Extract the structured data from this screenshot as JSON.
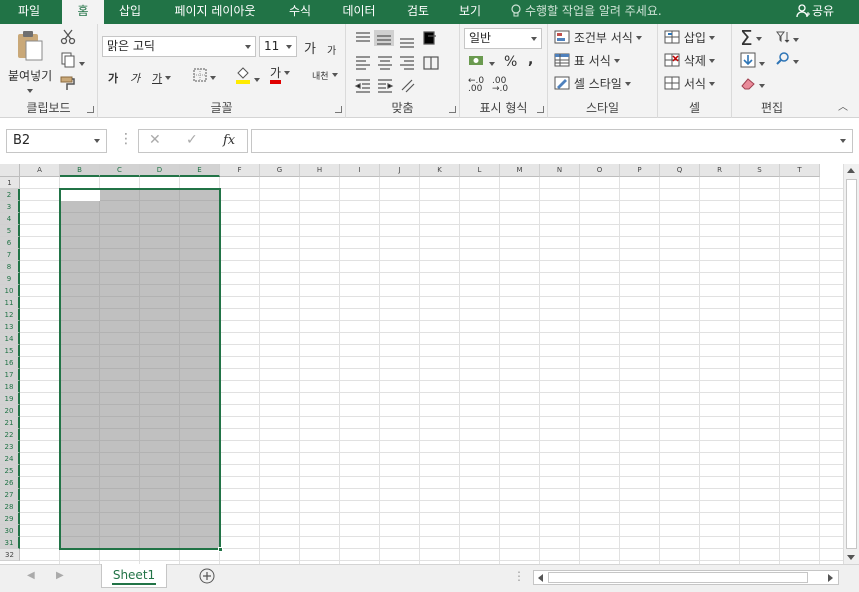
{
  "tabs": [
    "파일",
    "홈",
    "삽입",
    "페이지 레이아웃",
    "수식",
    "데이터",
    "검토",
    "보기"
  ],
  "active_tab": "홈",
  "tell_me": "수행할 작업을 알려 주세요.",
  "share": "공유",
  "ribbon": {
    "clipboard": {
      "paste": "붙여넣기",
      "label": "클립보드"
    },
    "font": {
      "name": "맑은 고딕",
      "size": "11",
      "grow": "가",
      "shrink": "가",
      "bold": "가",
      "italic": "가",
      "underline": "가",
      "color_a": "가",
      "phonetic": "내천",
      "label": "글꼴"
    },
    "align": {
      "label": "맞춤"
    },
    "number": {
      "format": "일반",
      "percent": "%",
      "comma": ",",
      "label": "표시 형식"
    },
    "styles": {
      "cond": "조건부 서식",
      "table": "표 서식",
      "cell": "셀 스타일",
      "label": "스타일"
    },
    "cells": {
      "insert": "삽입",
      "delete": "삭제",
      "format": "서식",
      "label": "셀"
    },
    "editing": {
      "label": "편집"
    }
  },
  "formula_bar": {
    "name_box": "B2",
    "fx": "fx",
    "value": ""
  },
  "columns": [
    "A",
    "B",
    "C",
    "D",
    "E",
    "F",
    "G",
    "H",
    "I",
    "J",
    "K",
    "L",
    "M",
    "N",
    "O",
    "P",
    "Q",
    "R",
    "S",
    "T"
  ],
  "selected_columns": [
    "B",
    "C",
    "D",
    "E"
  ],
  "rows": [
    "1",
    "2",
    "3",
    "4",
    "5",
    "6",
    "7",
    "8",
    "9",
    "10",
    "11",
    "12",
    "13",
    "14",
    "15",
    "16",
    "17",
    "18",
    "19",
    "20",
    "21",
    "22",
    "23",
    "24",
    "25",
    "26",
    "27",
    "28",
    "29",
    "30",
    "31",
    "32"
  ],
  "selection": {
    "range": "B2:E31",
    "active_cell": "B2"
  },
  "sheet_tab": "Sheet1",
  "colors": {
    "accent": "#217346",
    "selection_fill": "#c6c6c6"
  }
}
